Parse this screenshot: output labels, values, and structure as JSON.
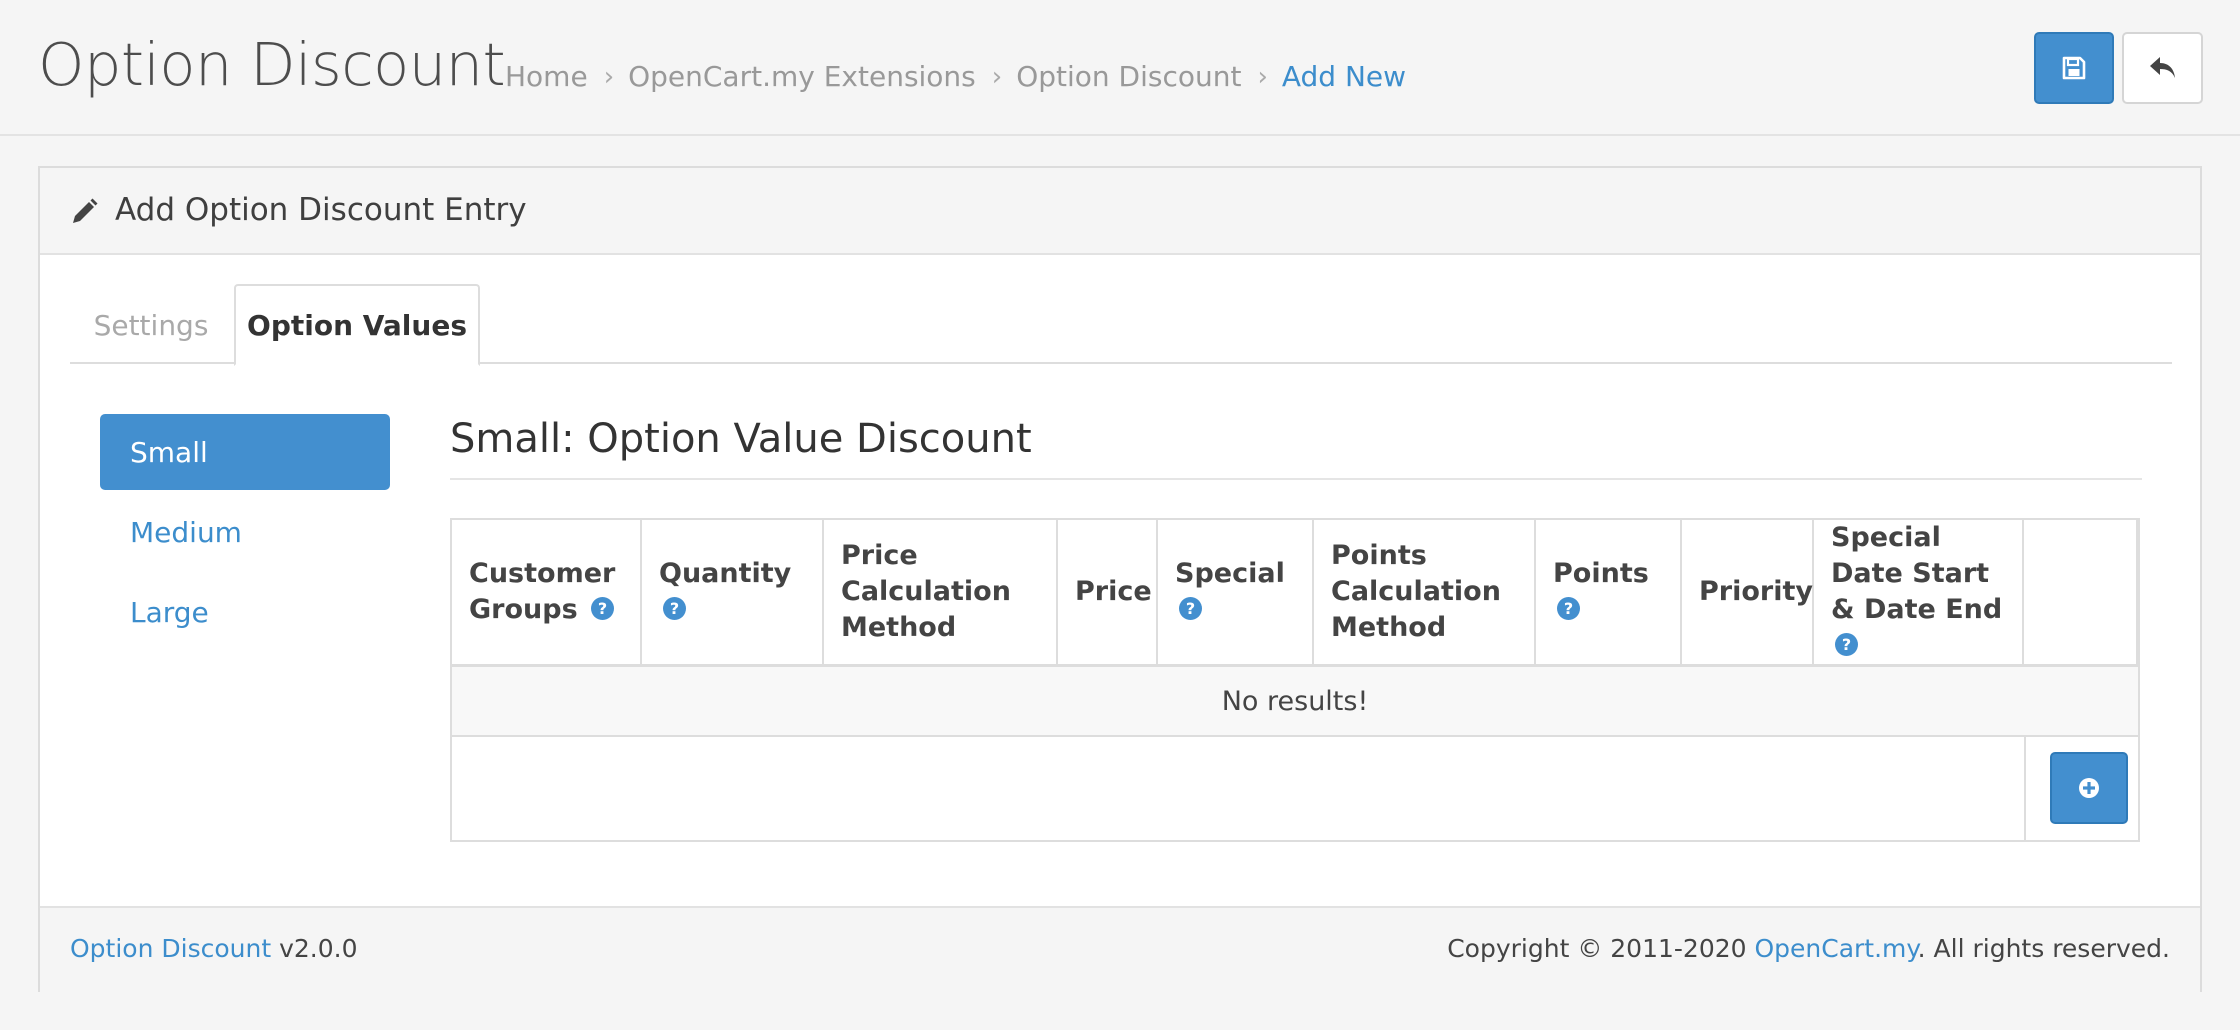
{
  "header": {
    "title": "Option Discount",
    "breadcrumb": [
      "Home",
      "OpenCart.my Extensions",
      "Option Discount",
      "Add New"
    ],
    "save_icon": "save-icon",
    "back_icon": "reply-icon"
  },
  "panel": {
    "title": "Add Option Discount Entry",
    "title_icon": "pencil-icon"
  },
  "tabs": [
    {
      "label": "Settings",
      "active": false
    },
    {
      "label": "Option Values",
      "active": true
    }
  ],
  "option_values": [
    {
      "label": "Small",
      "active": true
    },
    {
      "label": "Medium",
      "active": false
    },
    {
      "label": "Large",
      "active": false
    }
  ],
  "section": {
    "title": "Small: Option Value Discount"
  },
  "table": {
    "columns": [
      {
        "label": "Customer Groups",
        "help": true
      },
      {
        "label": "Quantity",
        "help": true
      },
      {
        "label": "Price Calculation Method",
        "help": false
      },
      {
        "label": "Price",
        "help": false
      },
      {
        "label": "Special",
        "help": true
      },
      {
        "label": "Points Calculation Method",
        "help": false
      },
      {
        "label": "Points",
        "help": true
      },
      {
        "label": "Priority",
        "help": false
      },
      {
        "label": "Special Date Start & Date End",
        "help": true
      },
      {
        "label": "",
        "help": false
      }
    ],
    "empty_text": "No results!",
    "add_icon": "plus-circle-icon"
  },
  "footer": {
    "product_link": "Option Discount",
    "version": "v2.0.0",
    "copyright_prefix": "Copyright © 2011-2020 ",
    "company_link": "OpenCart.my",
    "copyright_suffix": ". All rights reserved."
  },
  "colors": {
    "primary": "#438fcf",
    "link": "#3c8dcc",
    "background": "#f5f5f5"
  }
}
